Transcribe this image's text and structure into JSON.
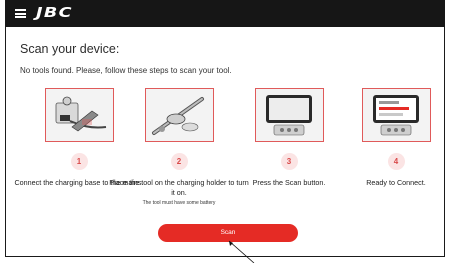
{
  "header": {
    "brand": "JBC",
    "menu_icon": "hamburger-menu-icon"
  },
  "page": {
    "title": "Scan your device:",
    "subtitle": "No tools found. Please, follow these steps to scan your tool."
  },
  "steps": [
    {
      "number": "1",
      "label": "Connect the charging base to the mains.",
      "note": "",
      "image_icon": "charging-base-illustration"
    },
    {
      "number": "2",
      "label": "Place the tool on the charging holder to turn it on.",
      "note": "The tool must have some battery",
      "image_icon": "tool-on-holder-illustration"
    },
    {
      "number": "3",
      "label": "Press the Scan button.",
      "note": "",
      "image_icon": "tablet-scan-illustration"
    },
    {
      "number": "4",
      "label": "Ready to Connect.",
      "note": "",
      "image_icon": "tablet-ready-illustration"
    }
  ],
  "actions": {
    "scan_label": "Scan"
  },
  "colors": {
    "accent": "#e52b25",
    "topbar": "#161616",
    "badge_bg": "#fbe4e4",
    "badge_text": "#d94a4a",
    "image_border": "#e05a5a"
  }
}
